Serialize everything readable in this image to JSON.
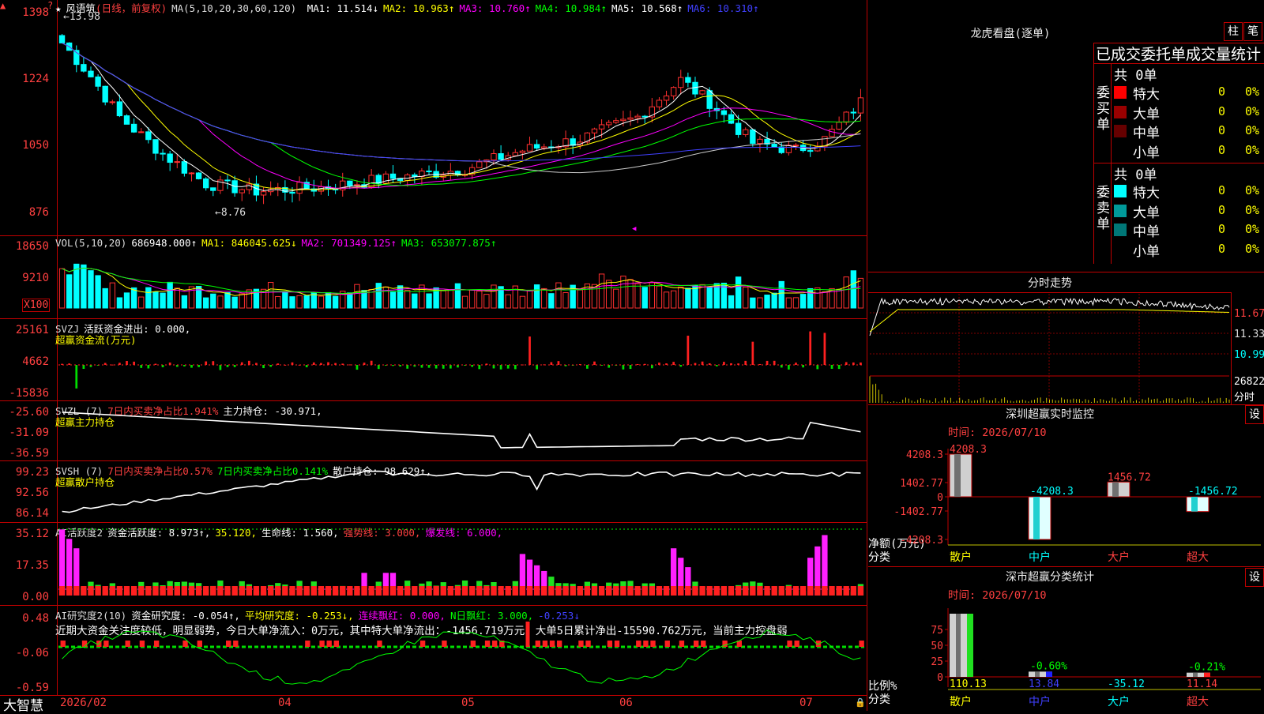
{
  "app": {
    "footer_brand": "大智慧"
  },
  "candle": {
    "stock": "风语筑",
    "period": "(日线，前复权)",
    "ma_spec": "MA(5,10,20,30,60,120)",
    "ma": [
      {
        "label": "MA1:",
        "value": "11.514↓",
        "color": "#ffffff"
      },
      {
        "label": "MA2:",
        "value": "10.963↑",
        "color": "#ffff00"
      },
      {
        "label": "MA3:",
        "value": "10.760↑",
        "color": "#ff00ff"
      },
      {
        "label": "MA4:",
        "value": "10.984↑",
        "color": "#00ff00"
      },
      {
        "label": "MA5:",
        "value": "10.568↑",
        "color": "#ffffff"
      },
      {
        "label": "MA6:",
        "value": "10.310↑",
        "color": "#4040ff"
      }
    ],
    "yticks": [
      "1398",
      "1224",
      "1050",
      "876"
    ],
    "high_note": "13.98",
    "low_note": "8.76"
  },
  "vol": {
    "label": "VOL(5,10,20)",
    "value": "686948.000↑",
    "ma": [
      {
        "label": "MA1:",
        "value": "846045.625↓",
        "color": "#ffff00"
      },
      {
        "label": "MA2:",
        "value": "701349.125↑",
        "color": "#ff00ff"
      },
      {
        "label": "MA3:",
        "value": "653077.875↑",
        "color": "#00ff00"
      }
    ],
    "yticks": [
      "18650",
      "9210"
    ],
    "unit": "X100"
  },
  "svzj": {
    "label": "SVZJ",
    "line1": "活跃资金进出: 0.000,",
    "line2": "超赢资金流(万元)",
    "yticks": [
      "25161",
      "4662",
      "-15836"
    ]
  },
  "svzl": {
    "label": "SVZL (7)",
    "t1": "7日内买卖净占比1.941%",
    "t2": "主力持仓: -30.971,",
    "line2": "超赢主力持仓",
    "yticks": [
      "-25.60",
      "-31.09",
      "-36.59"
    ]
  },
  "svsh": {
    "label": "SVSH (7)",
    "t1": "7日内买卖净占比0.57%",
    "t2": "7日内买卖净占比0.141%",
    "t3": "散户持仓: 98.629↑,",
    "line2": "超赢散户持仓",
    "yticks": [
      "99.23",
      "92.56",
      "86.14"
    ]
  },
  "ai_act": {
    "label": "AI活跃度2",
    "t1": "资金活跃度: 8.973↑,",
    "t2": "35.120,",
    "t3": "生命线: 1.560,",
    "t4": "强势线: 3.000,",
    "t5": "爆发线: 6.000,",
    "yticks": [
      "35.12",
      "17.35",
      "0.00"
    ]
  },
  "ai_res": {
    "label": "AI研究度2(10)",
    "t1": "资金研究度: -0.054↑,",
    "t2": "平均研究度: -0.253↓,",
    "t3": "连续飘红: 0.000,",
    "t4": "N日飘红: 3.000,",
    "t5": "-0.253↓",
    "commentary": "近期大资金关注度较低，明显弱势，今日大单净流入：0万元，其中特大单净流出：-1456.719万元，大单5日累计净出-15590.762万元，当前主力控盘弱",
    "yticks": [
      "0.48",
      "-0.06",
      "-0.59"
    ]
  },
  "xaxis": [
    "2026/02",
    "04",
    "05",
    "06",
    "07"
  ],
  "dragon": {
    "title": "龙虎看盘(逐单)",
    "btn1": "柱",
    "btn2": "笔",
    "header": "已成交委托单成交量统计",
    "buy_label": "委买单",
    "sell_label": "委卖单",
    "buy_total": "共 0单",
    "sell_total": "共 0单",
    "buy_rows": [
      {
        "name": "特大",
        "count": "0",
        "pct": "0%",
        "color": "#ff0000"
      },
      {
        "name": "大单",
        "count": "0",
        "pct": "0%",
        "color": "#990000"
      },
      {
        "name": "中单",
        "count": "0",
        "pct": "0%",
        "color": "#660000"
      },
      {
        "name": "小单",
        "count": "0",
        "pct": "0%",
        "color": "#000000"
      }
    ],
    "sell_rows": [
      {
        "name": "特大",
        "count": "0",
        "pct": "0%",
        "color": "#00ffff"
      },
      {
        "name": "大单",
        "count": "0",
        "pct": "0%",
        "color": "#009999"
      },
      {
        "name": "中单",
        "count": "0",
        "pct": "0%",
        "color": "#007777"
      },
      {
        "name": "小单",
        "count": "0",
        "pct": "0%",
        "color": "#000000"
      }
    ]
  },
  "intraday": {
    "title": "分时走势",
    "yticks": [
      "11.67",
      "11.33",
      "10.99"
    ],
    "vol_tick": "26822",
    "vol_unit": "分时"
  },
  "sz_monitor": {
    "title": "深圳超赢实时监控",
    "btn": "设",
    "time": "时间: 2026/07/10",
    "yticks": [
      "4208.3",
      "1402.77",
      "0",
      "-1402.77",
      "-4208.3"
    ],
    "ylabel1": "净额(万元)",
    "ylabel2": "分类",
    "bars": [
      {
        "cat": "散户",
        "value": "4208.3",
        "num": 4208.3,
        "cat_color": "#ffff00",
        "label_color": "#ff4040"
      },
      {
        "cat": "中户",
        "value": "-4208.3",
        "num": -4208.3,
        "cat_color": "#00ffff",
        "label_color": "#00ffff"
      },
      {
        "cat": "大户",
        "value": "1456.72",
        "num": 1456.72,
        "cat_color": "#ff4040",
        "label_color": "#ff4040"
      },
      {
        "cat": "超大",
        "value": "-1456.72",
        "num": -1456.72,
        "cat_color": "#ff4040",
        "label_color": "#00ffff"
      }
    ]
  },
  "sz_class": {
    "title": "深市超赢分类统计",
    "btn": "设",
    "time": "时间: 2026/07/10",
    "yticks": [
      "75",
      "50",
      "25",
      "0"
    ],
    "ylabel1": "比例%",
    "ylabel2": "分类",
    "bars": [
      {
        "cat": "散户",
        "value": "110.13",
        "num": 110.13,
        "top": "",
        "cat_color": "#ffff00",
        "label_color": "#ffff00"
      },
      {
        "cat": "中户",
        "value": "13.84",
        "num": 13.84,
        "top": "-0.60%",
        "cat_color": "#4040ff",
        "label_color": "#4040ff"
      },
      {
        "cat": "大户",
        "value": "-35.12",
        "num": -35.12,
        "top": "",
        "cat_color": "#00ffff",
        "label_color": "#00ffff"
      },
      {
        "cat": "超大",
        "value": "11.14",
        "num": 11.14,
        "top": "-0.21%",
        "cat_color": "#ff4040",
        "label_color": "#ff4040"
      }
    ]
  }
}
